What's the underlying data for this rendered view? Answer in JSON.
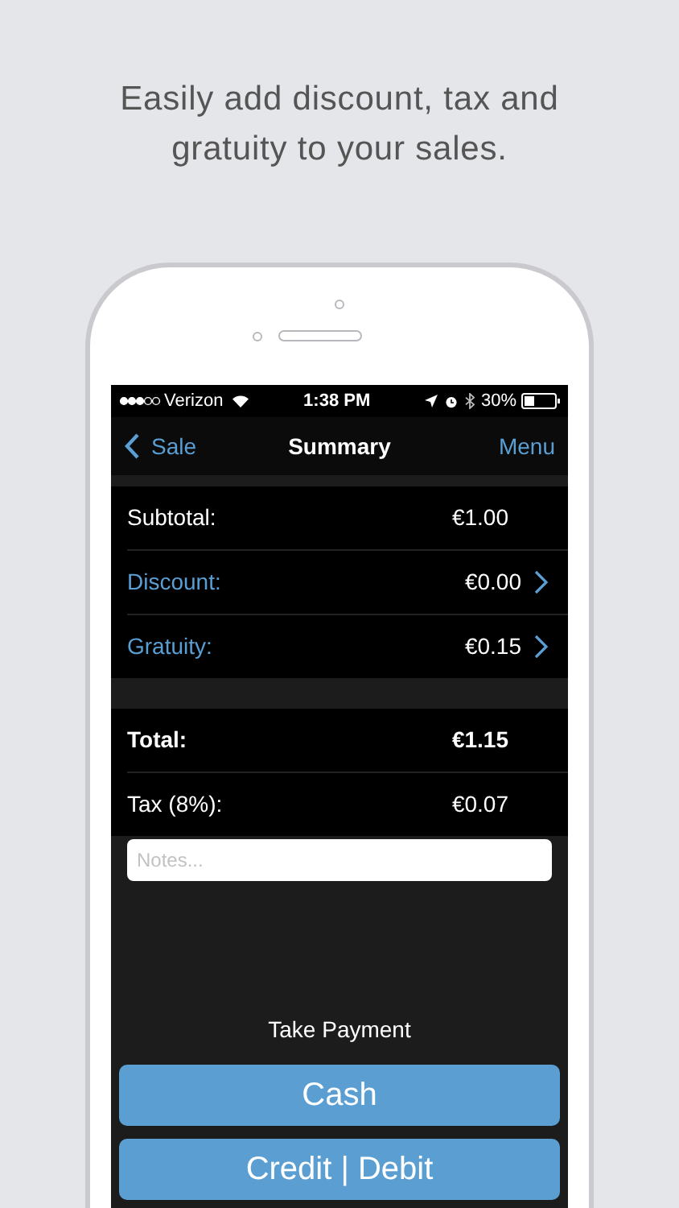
{
  "headline": "Easily add discount, tax and gratuity to your sales.",
  "status_bar": {
    "carrier": "Verizon",
    "time": "1:38 PM",
    "battery": "30%"
  },
  "nav_bar": {
    "back": "Sale",
    "title": "Summary",
    "action": "Menu"
  },
  "sections": [
    {
      "rows": [
        {
          "label": "Subtotal:",
          "value": "€1.00",
          "kind": "plain"
        },
        {
          "label": "Discount:",
          "value": "€0.00",
          "kind": "link"
        },
        {
          "label": "Gratuity:",
          "value": "€0.15",
          "kind": "link"
        }
      ]
    },
    {
      "rows": [
        {
          "label": "Total:",
          "value": "€1.15",
          "kind": "bold"
        },
        {
          "label": "Tax (8%):",
          "value": "€0.07",
          "kind": "plain"
        }
      ]
    }
  ],
  "notes": {
    "placeholder": "Notes..."
  },
  "payment": {
    "title": "Take Payment",
    "buttons": [
      "Cash",
      "Credit | Debit"
    ]
  }
}
